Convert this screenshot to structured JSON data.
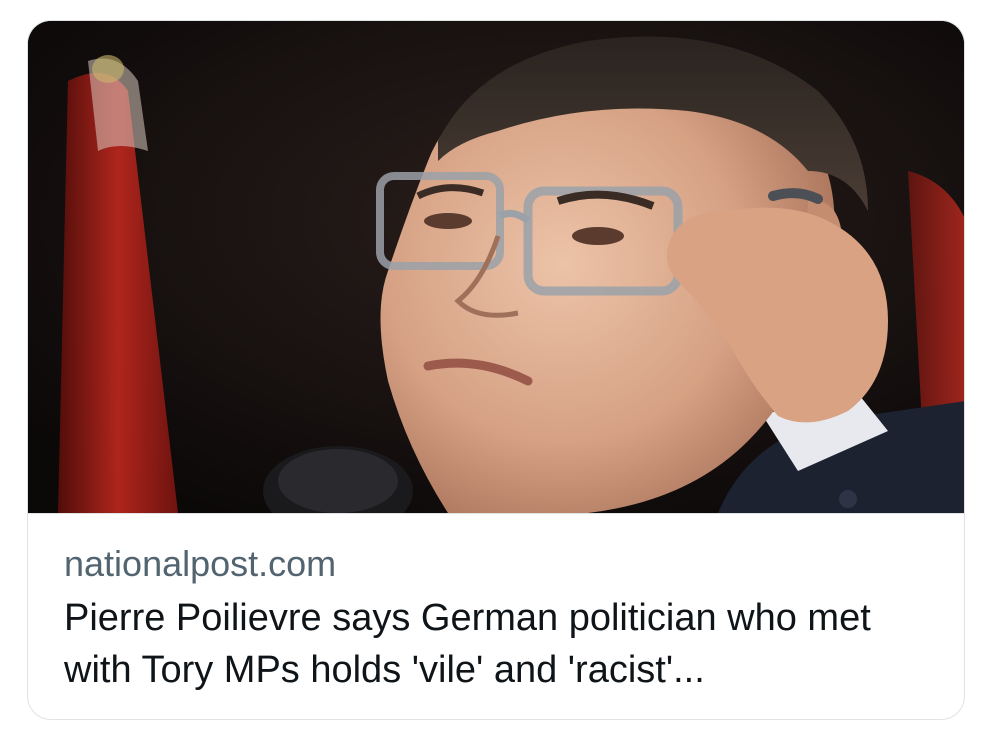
{
  "link_card": {
    "image": {
      "subject": "photo-person-adjusting-glasses"
    },
    "domain": "nationalpost.com",
    "headline": "Pierre Poilievre says German politician who met with Tory MPs holds 'vile' and 'racist'..."
  },
  "colors": {
    "domain_text": "#536471",
    "headline_text": "#0f1419",
    "card_border": "#dfe3e6",
    "flag_red": "#c0281e"
  }
}
